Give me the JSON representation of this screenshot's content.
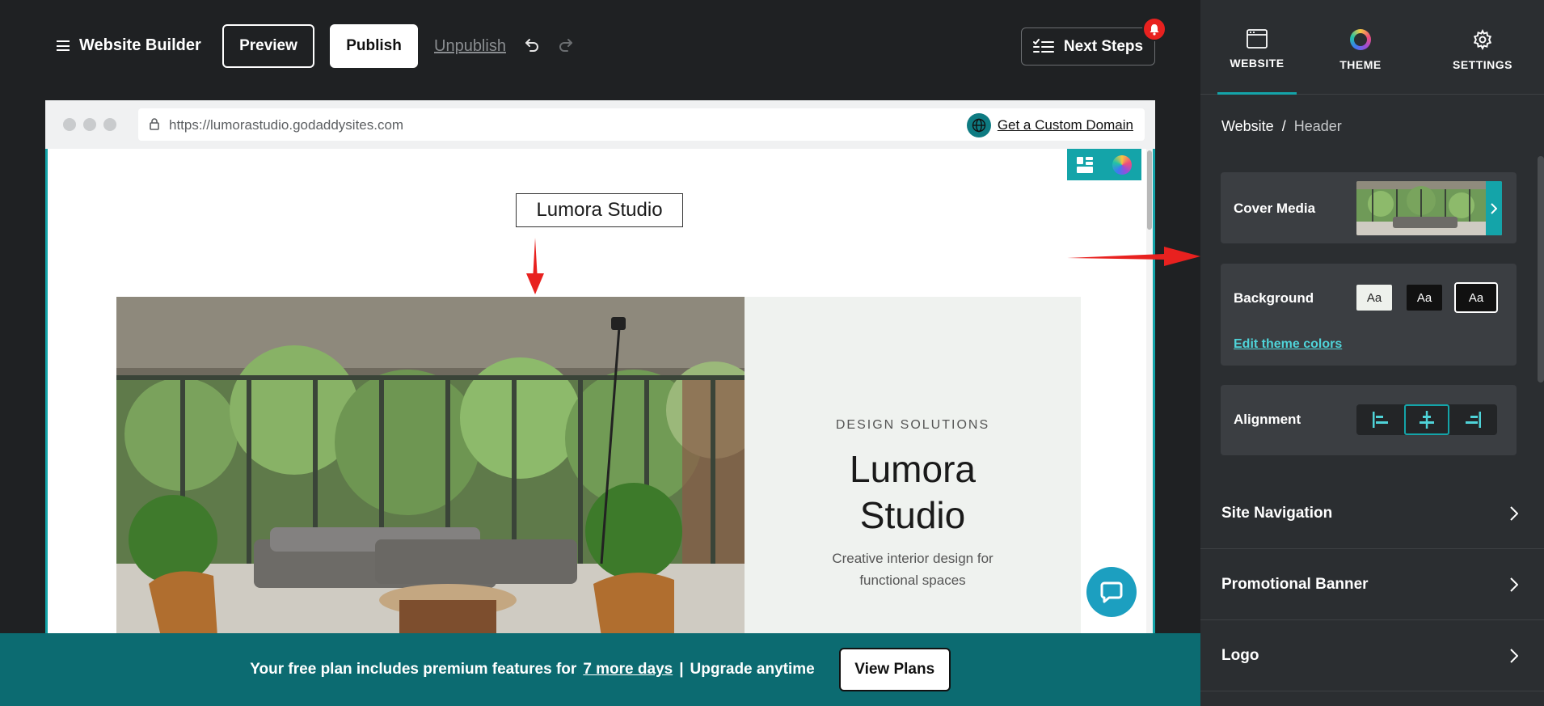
{
  "topbar": {
    "brand": "Website Builder",
    "preview": "Preview",
    "publish": "Publish",
    "unpublish": "Unpublish",
    "next_steps": "Next Steps"
  },
  "browser": {
    "url": "https://lumorastudio.godaddysites.com",
    "custom_domain": "Get a Custom Domain"
  },
  "site": {
    "logo_text": "Lumora Studio",
    "kicker": "DESIGN SOLUTIONS",
    "title_line1": "Lumora",
    "title_line2": "Studio",
    "subtitle_line1": "Creative interior design for",
    "subtitle_line2": "functional spaces"
  },
  "banner": {
    "text_before": "Your free plan includes premium features for",
    "link": "7 more days",
    "separator": "|",
    "text_after": "Upgrade anytime",
    "button": "View Plans"
  },
  "panel": {
    "tabs": [
      {
        "label": "WEBSITE",
        "icon": "browser-window-icon",
        "active": true
      },
      {
        "label": "THEME",
        "icon": "color-ring-icon",
        "active": false
      },
      {
        "label": "SETTINGS",
        "icon": "gear-icon",
        "active": false
      }
    ],
    "breadcrumb": {
      "root": "Website",
      "sep": "/",
      "current": "Header"
    },
    "cover_media": "Cover Media",
    "background": {
      "label": "Background",
      "swatch_labels": [
        "Aa",
        "Aa",
        "Aa"
      ],
      "selected_index": 2,
      "edit_link": "Edit theme colors"
    },
    "alignment": {
      "label": "Alignment",
      "options": [
        "left",
        "center",
        "right"
      ],
      "selected": "center"
    },
    "sections": [
      "Site Navigation",
      "Promotional Banner",
      "Logo"
    ]
  },
  "colors": {
    "accent": "#14a4a9",
    "banner": "#0c6b71",
    "panel_bg": "#2b2e31",
    "app_bg": "#1f2123",
    "annotation_arrow": "#e8211f"
  }
}
